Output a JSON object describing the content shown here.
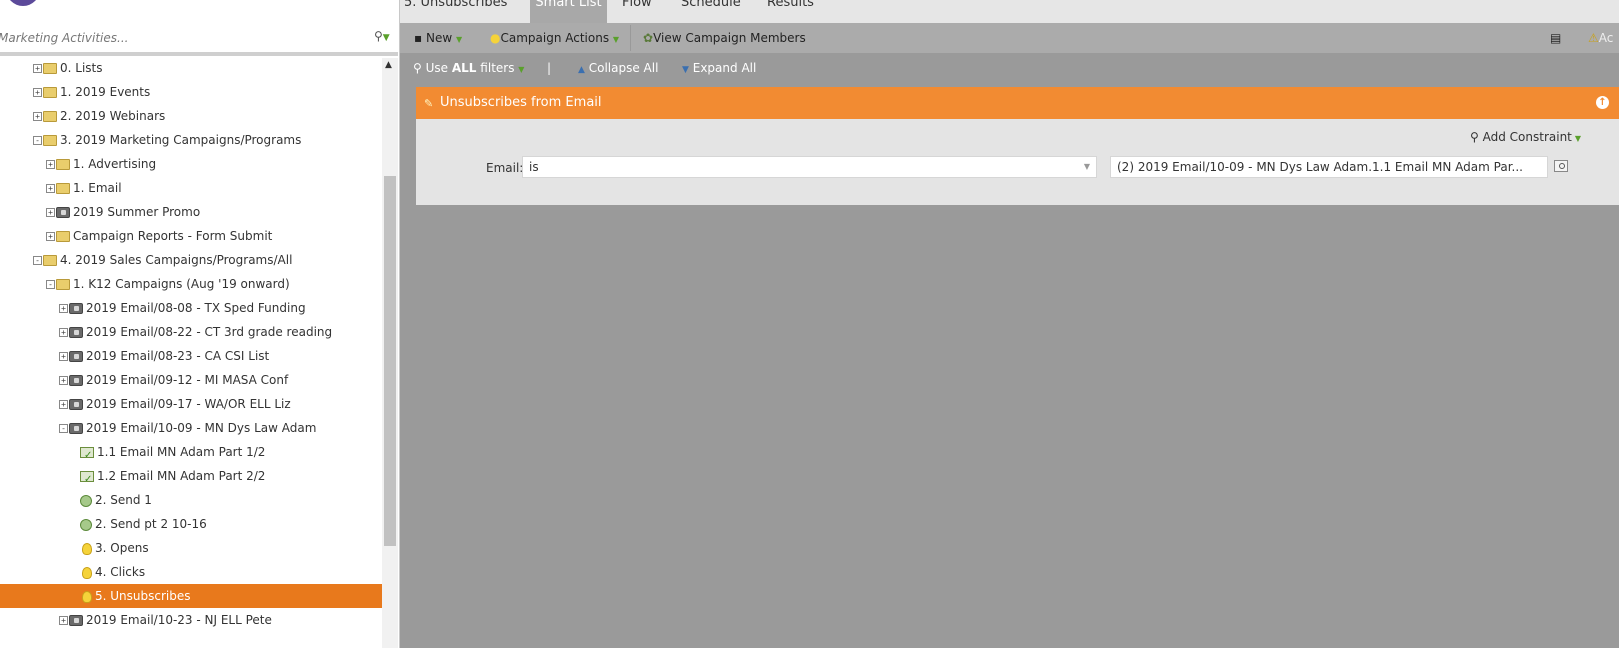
{
  "sidebar": {
    "search_placeholder": "Marketing Activities...",
    "tree": [
      {
        "label": "0. Lists",
        "icon": "folder",
        "toggle": "+"
      },
      {
        "label": "1. 2019 Events",
        "icon": "folder",
        "toggle": "+"
      },
      {
        "label": "2. 2019 Webinars",
        "icon": "folder",
        "toggle": "+"
      },
      {
        "label": "3. 2019 Marketing Campaigns/Programs",
        "icon": "folder",
        "toggle": "-"
      },
      {
        "label": "1. Advertising",
        "icon": "folder",
        "toggle": "+"
      },
      {
        "label": "1. Email",
        "icon": "folder",
        "toggle": "+"
      },
      {
        "label": "2019 Summer Promo",
        "icon": "program",
        "toggle": "+"
      },
      {
        "label": "Campaign Reports - Form Submit",
        "icon": "folder",
        "toggle": "+"
      },
      {
        "label": "4. 2019 Sales Campaigns/Programs/All",
        "icon": "folder",
        "toggle": "-"
      },
      {
        "label": "1. K12 Campaigns (Aug '19 onward)",
        "icon": "folder",
        "toggle": "-"
      },
      {
        "label": "2019 Email/08-08 - TX Sped Funding",
        "icon": "program",
        "toggle": "+"
      },
      {
        "label": "2019 Email/08-22 - CT 3rd grade reading",
        "icon": "program",
        "toggle": "+"
      },
      {
        "label": "2019 Email/08-23 - CA CSI List",
        "icon": "program",
        "toggle": "+"
      },
      {
        "label": "2019 Email/09-12 - MI MASA Conf",
        "icon": "program",
        "toggle": "+"
      },
      {
        "label": "2019 Email/09-17 - WA/OR ELL Liz",
        "icon": "program",
        "toggle": "+"
      },
      {
        "label": "2019 Email/10-09 - MN Dys Law Adam",
        "icon": "program",
        "toggle": "-"
      },
      {
        "label": "1.1 Email MN Adam Part 1/2",
        "icon": "email",
        "toggle": ""
      },
      {
        "label": "1.2 Email MN Adam Part 2/2",
        "icon": "email",
        "toggle": ""
      },
      {
        "label": "2. Send 1",
        "icon": "batch",
        "toggle": ""
      },
      {
        "label": "2. Send pt 2 10-16",
        "icon": "batch",
        "toggle": ""
      },
      {
        "label": "3. Opens",
        "icon": "bulb",
        "toggle": ""
      },
      {
        "label": "4. Clicks",
        "icon": "bulb",
        "toggle": ""
      },
      {
        "label": "5. Unsubscribes",
        "icon": "bulb",
        "toggle": "",
        "selected": true
      },
      {
        "label": "2019 Email/10-23 - NJ ELL Pete",
        "icon": "program",
        "toggle": "+"
      }
    ]
  },
  "tabs": [
    {
      "label": "5. Unsubscribes"
    },
    {
      "label": "Smart List",
      "active": true
    },
    {
      "label": "Flow"
    },
    {
      "label": "Schedule"
    },
    {
      "label": "Results"
    }
  ],
  "toolbar": {
    "new_label": "New",
    "campaign_actions_label": "Campaign Actions",
    "view_members_label": "View Campaign Members",
    "right_label": "Ac"
  },
  "filterbar": {
    "use_prefix": "Use",
    "use_emph": "ALL",
    "use_suffix": "filters",
    "separator": "|",
    "collapse_all": "Collapse All",
    "expand_all": "Expand All"
  },
  "filter": {
    "title": "Unsubscribes from Email",
    "add_constraint": "Add Constraint",
    "field_label": "Email:",
    "operator": "is",
    "value": "(2) 2019 Email/10-09 - MN Dys Law Adam.1.1 Email MN Adam Par..."
  },
  "colors": {
    "accent_orange": "#f28b32",
    "selected_orange": "#e8791c",
    "green_arrow": "#5aa02c"
  }
}
